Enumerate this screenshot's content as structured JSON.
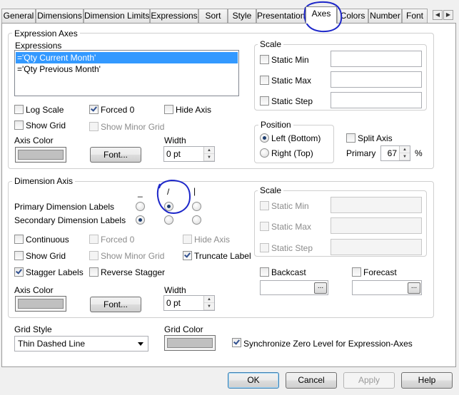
{
  "tabs": [
    {
      "label": "General"
    },
    {
      "label": "Dimensions"
    },
    {
      "label": "Dimension Limits"
    },
    {
      "label": "Expressions"
    },
    {
      "label": "Sort"
    },
    {
      "label": "Style"
    },
    {
      "label": "Presentation"
    },
    {
      "label": "Axes"
    },
    {
      "label": "Colors"
    },
    {
      "label": "Number"
    },
    {
      "label": "Font"
    }
  ],
  "active_tab": "Axes",
  "expression_axes": {
    "title": "Expression Axes",
    "expressions_label": "Expressions",
    "expressions": [
      {
        "text": "='Qty Current Month'",
        "selected": true
      },
      {
        "text": "='Qty Previous Month'",
        "selected": false
      }
    ],
    "log_scale": {
      "label": "Log Scale",
      "checked": false
    },
    "forced_0": {
      "label": "Forced 0",
      "checked": true
    },
    "hide_axis": {
      "label": "Hide Axis",
      "checked": false
    },
    "show_grid": {
      "label": "Show Grid",
      "checked": false
    },
    "show_minor_grid": {
      "label": "Show Minor Grid",
      "checked": false
    },
    "axis_color_label": "Axis Color",
    "font_button": "Font...",
    "width_label": "Width",
    "width_value": "0 pt",
    "scale": {
      "title": "Scale",
      "static_min": "Static Min",
      "static_max": "Static Max",
      "static_step": "Static Step"
    },
    "position": {
      "title": "Position",
      "left_bottom": "Left (Bottom)",
      "right_top": "Right (Top)",
      "selected": "Left (Bottom)"
    },
    "split_axis": {
      "label": "Split Axis",
      "checked": false
    },
    "primary_label": "Primary",
    "primary_value": "67",
    "primary_unit": "%"
  },
  "dimension_axis": {
    "title": "Dimension Axis",
    "orientation_glyphs": [
      "_",
      "/",
      "|"
    ],
    "primary_labels": "Primary Dimension Labels",
    "secondary_labels": "Secondary Dimension Labels",
    "primary_selected": "/",
    "secondary_selected": "_",
    "continuous": {
      "label": "Continuous",
      "checked": false
    },
    "forced_0": {
      "label": "Forced 0",
      "checked": false
    },
    "hide_axis": {
      "label": "Hide Axis",
      "checked": false
    },
    "show_grid": {
      "label": "Show Grid",
      "checked": false
    },
    "show_minor_grid": {
      "label": "Show Minor Grid",
      "checked": false
    },
    "truncate_label": {
      "label": "Truncate Label",
      "checked": true
    },
    "stagger_labels": {
      "label": "Stagger Labels",
      "checked": true
    },
    "reverse_stagger": {
      "label": "Reverse Stagger",
      "checked": false
    },
    "axis_color_label": "Axis Color",
    "font_button": "Font...",
    "width_label": "Width",
    "width_value": "0 pt",
    "scale": {
      "title": "Scale",
      "static_min": "Static Min",
      "static_max": "Static Max",
      "static_step": "Static Step"
    },
    "backcast": {
      "label": "Backcast",
      "checked": false
    },
    "forecast": {
      "label": "Forecast",
      "checked": false
    },
    "ellipsis": "..."
  },
  "grid_style": {
    "label": "Grid Style",
    "value": "Thin Dashed Line"
  },
  "grid_color_label": "Grid Color",
  "sync_zero": {
    "label": "Synchronize Zero Level for Expression-Axes",
    "checked": true
  },
  "buttons": {
    "ok": "OK",
    "cancel": "Cancel",
    "apply": "Apply",
    "help": "Help"
  },
  "colors": {
    "selection": "#3399ff",
    "annotation": "#1d27c9",
    "swatch": "#c0c0c0"
  },
  "tab_scroll_glyphs": [
    "◀",
    "▶"
  ]
}
